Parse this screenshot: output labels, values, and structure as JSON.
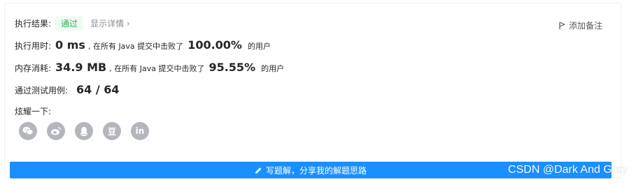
{
  "result": {
    "label": "执行结果:",
    "status": "通过",
    "detail_link": "显示详情 ›",
    "add_note": "添加备注"
  },
  "runtime": {
    "label": "执行用时:",
    "value": "0 ms",
    "beat_text": ", 在所有 Java 提交中击败了",
    "percent": "100.00%",
    "users_text": "的用户"
  },
  "memory": {
    "label": "内存消耗:",
    "value": "34.9 MB",
    "beat_text": ", 在所有 Java 提交中击败了",
    "percent": "95.55%",
    "users_text": "的用户"
  },
  "testcases": {
    "label": "通过测试用例:",
    "value": "64 / 64"
  },
  "share": {
    "label": "炫耀一下:",
    "buttons": [
      {
        "icon": "wechat-icon"
      },
      {
        "icon": "weibo-icon"
      },
      {
        "icon": "qq-icon"
      },
      {
        "icon": "douban-icon",
        "text": "豆"
      },
      {
        "icon": "linkedin-icon",
        "text": "in"
      }
    ]
  },
  "write_solution": {
    "label": "写题解，分享我的解题思路",
    "icon": "pencil-icon"
  },
  "watermark": "CSDN @Dark And Grey",
  "colors": {
    "accent": "#1a90ff",
    "success": "#2db55d",
    "success_bg": "#f0faf2",
    "icon_gray": "#b4b6bd"
  }
}
